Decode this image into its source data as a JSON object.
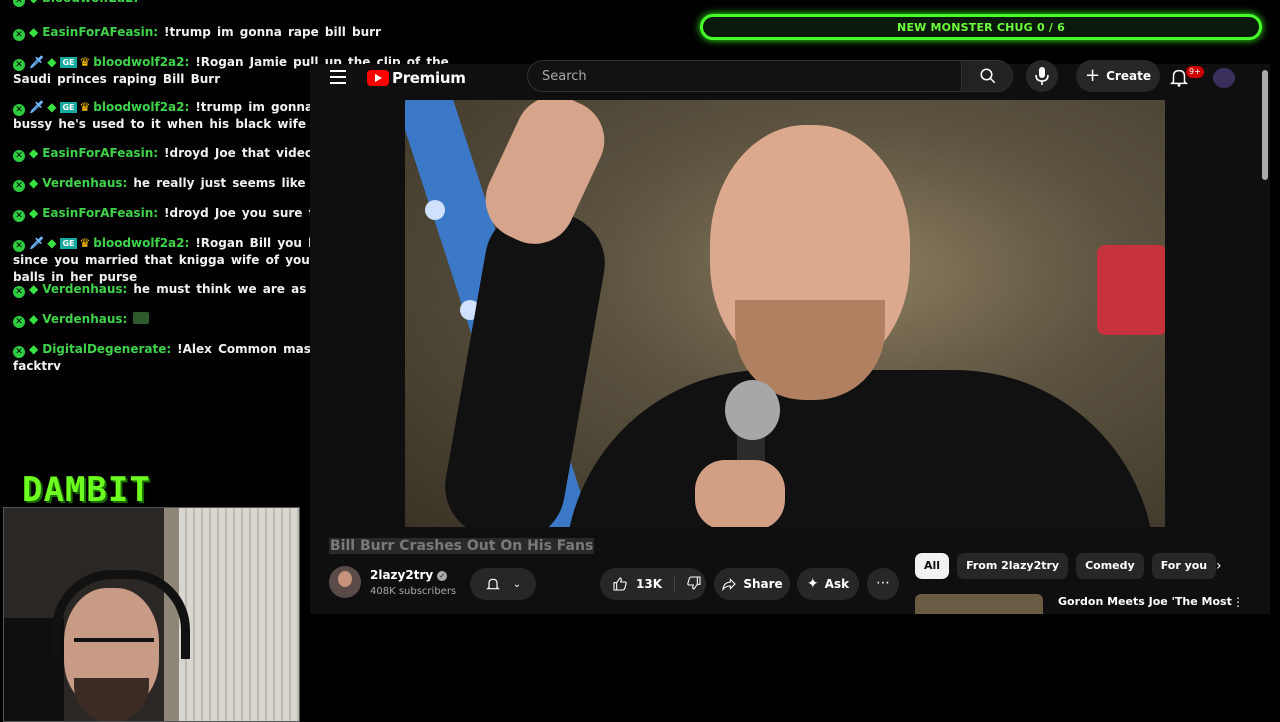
{
  "chat": {
    "messages": [
      {
        "user": "EasinForAFeasin:",
        "text": "!trump im gonna rape bill burr",
        "badges": "basic"
      },
      {
        "user": "bloodwolf2a2:",
        "text": "!Rogan Jamie pull up the clip of the Saudi princes raping Bill Burr",
        "badges": "full"
      },
      {
        "user": "bloodwolf2a2:",
        "text": "!trump im gonna rayp Bill Burr's bussy he's used to it when his black wife pegs him",
        "badges": "full"
      },
      {
        "user": "EasinForAFeasin:",
        "text": "!droyd Joe that video is crazy",
        "badges": "basic"
      },
      {
        "user": "Verdenhaus:",
        "text": "he really just seems like a pathetic douche.",
        "badges": "basic"
      },
      {
        "user": "EasinForAFeasin:",
        "text": "!droyd Joe you sure this ain't ai nicka",
        "badges": "basic"
      },
      {
        "user": "bloodwolf2a2:",
        "text": "!Rogan Bill you haven't been funny since you married that knigga wife of yours she has your balls in her purse",
        "badges": "full"
      },
      {
        "user": "Verdenhaus:",
        "text": "he must think we are as stupid as he is?",
        "badges": "basic"
      },
      {
        "user": "Verdenhaus:",
        "text": "",
        "badges": "basic"
      },
      {
        "user": "DigitalDegenerate:",
        "text": "!Alex Common masshole type of facktry",
        "badges": "basic"
      }
    ]
  },
  "logo": "DAMBIT",
  "chug_bar": {
    "label": "NEW MONSTER CHUG 0 / 6",
    "progress": 0
  },
  "youtube": {
    "brand": "Premium",
    "search_placeholder": "Search",
    "create_label": "Create",
    "notif_badge": "9+",
    "video_title": "Bill Burr Crashes Out On His Fans",
    "channel_name": "2lazy2try",
    "subscribers": "408K subscribers",
    "likes": "13K",
    "share_label": "Share",
    "ask_label": "Ask",
    "chips": [
      "All",
      "From 2lazy2try",
      "Comedy",
      "For you"
    ],
    "rec_title": "Gordon Meets Joe 'The Most"
  },
  "colors": {
    "accent_green": "#46ff2b",
    "yt_red": "#ff0000"
  }
}
